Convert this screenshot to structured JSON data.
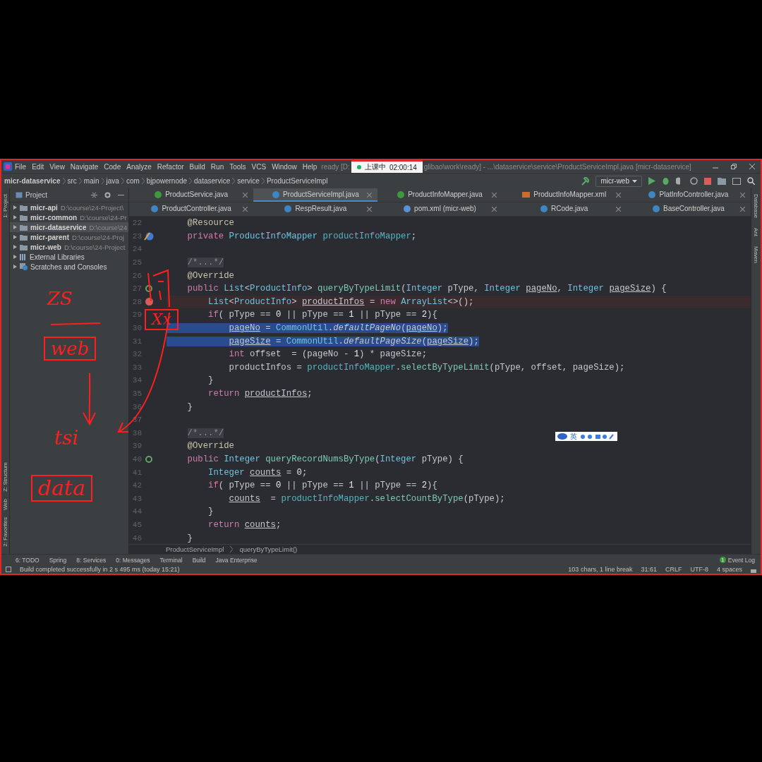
{
  "recording_widget": {
    "status": "上课中",
    "time": "02:00:14"
  },
  "menu": [
    "File",
    "Edit",
    "View",
    "Navigate",
    "Code",
    "Analyze",
    "Refactor",
    "Build",
    "Run",
    "Tools",
    "VCS",
    "Window",
    "Help"
  ],
  "window": {
    "title_start": "ready [D:",
    "title_end": "glibao\\work\\ready] - ...\\dataservice\\service\\ProductServiceImpl.java [micr-dataservice]"
  },
  "navigation": [
    "micr-dataservice",
    "src",
    "main",
    "java",
    "com",
    "bjpowernode",
    "dataservice",
    "service",
    "ProductServiceImpl"
  ],
  "run_config": "micr-web",
  "left_stripe": [
    "1: Project",
    "Z: Structure",
    "Web",
    "2: Favorites"
  ],
  "right_stripe": [
    "Database",
    "Ant",
    "Maven"
  ],
  "project_panel": {
    "title": "Project",
    "items": [
      {
        "name": "micr-api",
        "path": "D:\\course\\24-Project\\",
        "kind": "module",
        "selected": false
      },
      {
        "name": "micr-common",
        "path": "D:\\course\\24-Pr",
        "kind": "module",
        "selected": false
      },
      {
        "name": "micr-dataservice",
        "path": "D:\\course\\24",
        "kind": "module",
        "selected": true
      },
      {
        "name": "micr-parent",
        "path": "D:\\course\\24-Proj",
        "kind": "module",
        "selected": false
      },
      {
        "name": "micr-web",
        "path": "D:\\course\\24-Project",
        "kind": "module",
        "selected": false
      },
      {
        "name": "External Libraries",
        "kind": "libraries",
        "selected": false
      },
      {
        "name": "Scratches and Consoles",
        "kind": "scratches",
        "selected": false
      }
    ]
  },
  "tab_rows": [
    [
      {
        "label": "ProductService.java",
        "kind": "interface",
        "selected": false
      },
      {
        "label": "ProductServiceImpl.java",
        "kind": "class",
        "selected": true
      },
      {
        "label": "ProductInfoMapper.java",
        "kind": "interface",
        "selected": false
      },
      {
        "label": "ProductInfoMapper.xml",
        "kind": "xml",
        "selected": false
      },
      {
        "label": "PlatInfoController.java",
        "kind": "class",
        "selected": false
      }
    ],
    [
      {
        "label": "ProductController.java",
        "kind": "class",
        "selected": false
      },
      {
        "label": "RespResult.java",
        "kind": "class",
        "selected": false
      },
      {
        "label": "pom.xml (micr-web)",
        "kind": "maven",
        "selected": false
      },
      {
        "label": "RCode.java",
        "kind": "enum",
        "selected": false
      },
      {
        "label": "BaseController.java",
        "kind": "class",
        "selected": false
      }
    ]
  ],
  "code_lines": [
    {
      "number": "22",
      "tokens": [
        {
          "kind": "annotation",
          "text": "    @Resource"
        }
      ]
    },
    {
      "number": "23",
      "gutter_icon": {
        "kind": "bean"
      },
      "tokens": [
        {
          "kind": "keyword",
          "text": "    private "
        },
        {
          "kind": "type",
          "text": "ProductInfoMapper "
        },
        {
          "kind": "field",
          "text": "productInfoMapper"
        },
        {
          "kind": "plain",
          "text": ";"
        }
      ]
    },
    {
      "number": "24"
    },
    {
      "number": "25",
      "tokens": [
        {
          "kind": "fold",
          "text": "    /*...*/"
        }
      ]
    },
    {
      "number": "26",
      "tokens": [
        {
          "kind": "annotation",
          "text": "    @Override"
        }
      ]
    },
    {
      "number": "27",
      "gutter_icon": {
        "kind": "override"
      },
      "tokens": [
        {
          "kind": "keyword",
          "text": "    public "
        },
        {
          "kind": "type",
          "text": "List"
        },
        {
          "kind": "plain",
          "text": "<"
        },
        {
          "kind": "type",
          "text": "ProductInfo"
        },
        {
          "kind": "plain",
          "text": "> "
        },
        {
          "kind": "method",
          "text": "queryByTypeLimit"
        },
        {
          "kind": "plain",
          "text": "("
        },
        {
          "kind": "type",
          "text": "Integer "
        },
        {
          "kind": "plain",
          "text": "pType, "
        },
        {
          "kind": "type",
          "text": "Integer "
        },
        {
          "kind": "variable",
          "text": "pageNo"
        },
        {
          "kind": "plain",
          "text": ", "
        },
        {
          "kind": "type",
          "text": "Integer "
        },
        {
          "kind": "variable",
          "text": "pageSize"
        },
        {
          "kind": "plain",
          "text": ") {"
        }
      ]
    },
    {
      "number": "28",
      "breakpoint": true,
      "tokens": [
        {
          "kind": "type",
          "text": "        List"
        },
        {
          "kind": "plain",
          "text": "<"
        },
        {
          "kind": "type",
          "text": "ProductInfo"
        },
        {
          "kind": "plain",
          "text": "> "
        },
        {
          "kind": "variable",
          "text": "productInfos"
        },
        {
          "kind": "plain",
          "text": " = "
        },
        {
          "kind": "keyword",
          "text": "new "
        },
        {
          "kind": "type",
          "text": "ArrayList"
        },
        {
          "kind": "plain",
          "text": "<>();"
        }
      ]
    },
    {
      "number": "29",
      "tokens": [
        {
          "kind": "keyword",
          "text": "        if"
        },
        {
          "kind": "plain",
          "text": "( pType == "
        },
        {
          "kind": "number",
          "text": "0"
        },
        {
          "kind": "plain",
          "text": " || pType == "
        },
        {
          "kind": "number",
          "text": "1"
        },
        {
          "kind": "plain",
          "text": " || pType == "
        },
        {
          "kind": "number",
          "text": "2"
        },
        {
          "kind": "plain",
          "text": "){"
        }
      ]
    },
    {
      "number": "30",
      "selected": true,
      "tokens": [
        {
          "kind": "variable",
          "text": "            pageNo"
        },
        {
          "kind": "plain",
          "text": " = "
        },
        {
          "kind": "type",
          "text": "CommonUtil"
        },
        {
          "kind": "plain",
          "text": "."
        },
        {
          "kind": "static",
          "text": "defaultPageNo"
        },
        {
          "kind": "plain",
          "text": "("
        },
        {
          "kind": "variable",
          "text": "pageNo"
        },
        {
          "kind": "plain",
          "text": ");"
        }
      ]
    },
    {
      "number": "31",
      "selected": true,
      "tokens": [
        {
          "kind": "variable",
          "text": "            pageSize"
        },
        {
          "kind": "plain",
          "text": " = "
        },
        {
          "kind": "type",
          "text": "CommonUtil"
        },
        {
          "kind": "plain",
          "text": "."
        },
        {
          "kind": "static",
          "text": "defaultPageSize"
        },
        {
          "kind": "plain",
          "text": "("
        },
        {
          "kind": "variable",
          "text": "pageSize"
        },
        {
          "kind": "plain",
          "text": ");"
        }
      ]
    },
    {
      "number": "32",
      "tokens": [
        {
          "kind": "keyword",
          "text": "            int "
        },
        {
          "kind": "plain",
          "text": "offset  = (pageNo - "
        },
        {
          "kind": "number",
          "text": "1"
        },
        {
          "kind": "plain",
          "text": ") * pageSize;"
        }
      ]
    },
    {
      "number": "33",
      "tokens": [
        {
          "kind": "plain",
          "text": "            productInfos = "
        },
        {
          "kind": "field",
          "text": "productInfoMapper"
        },
        {
          "kind": "plain",
          "text": "."
        },
        {
          "kind": "method",
          "text": "selectByTypeLimit"
        },
        {
          "kind": "plain",
          "text": "(pType, offset, pageSize);"
        }
      ]
    },
    {
      "number": "34",
      "tokens": [
        {
          "kind": "plain",
          "text": "        }"
        }
      ]
    },
    {
      "number": "35",
      "tokens": [
        {
          "kind": "keyword",
          "text": "        return "
        },
        {
          "kind": "variable",
          "text": "productInfos"
        },
        {
          "kind": "plain",
          "text": ";"
        }
      ]
    },
    {
      "number": "36",
      "tokens": [
        {
          "kind": "plain",
          "text": "    }"
        }
      ]
    },
    {
      "number": "37"
    },
    {
      "number": "38",
      "tokens": [
        {
          "kind": "fold",
          "text": "    /*...*/"
        }
      ]
    },
    {
      "number": "39",
      "tokens": [
        {
          "kind": "annotation",
          "text": "    @Override"
        }
      ]
    },
    {
      "number": "40",
      "gutter_icon": {
        "kind": "override"
      },
      "tokens": [
        {
          "kind": "keyword",
          "text": "    public "
        },
        {
          "kind": "type",
          "text": "Integer "
        },
        {
          "kind": "method",
          "text": "queryRecordNumsByType"
        },
        {
          "kind": "plain",
          "text": "("
        },
        {
          "kind": "type",
          "text": "Integer "
        },
        {
          "kind": "plain",
          "text": "pType) {"
        }
      ]
    },
    {
      "number": "41",
      "tokens": [
        {
          "kind": "type",
          "text": "        Integer "
        },
        {
          "kind": "variable",
          "text": "counts"
        },
        {
          "kind": "plain",
          "text": " = "
        },
        {
          "kind": "number",
          "text": "0"
        },
        {
          "kind": "plain",
          "text": ";"
        }
      ]
    },
    {
      "number": "42",
      "tokens": [
        {
          "kind": "keyword",
          "text": "        if"
        },
        {
          "kind": "plain",
          "text": "( pType == "
        },
        {
          "kind": "number",
          "text": "0"
        },
        {
          "kind": "plain",
          "text": " || pType == "
        },
        {
          "kind": "number",
          "text": "1"
        },
        {
          "kind": "plain",
          "text": " || pType == "
        },
        {
          "kind": "number",
          "text": "2"
        },
        {
          "kind": "plain",
          "text": "){"
        }
      ]
    },
    {
      "number": "43",
      "tokens": [
        {
          "kind": "variable",
          "text": "            counts"
        },
        {
          "kind": "plain",
          "text": "  = "
        },
        {
          "kind": "field",
          "text": "productInfoMapper"
        },
        {
          "kind": "plain",
          "text": "."
        },
        {
          "kind": "method",
          "text": "selectCountByType"
        },
        {
          "kind": "plain",
          "text": "(pType);"
        }
      ]
    },
    {
      "number": "44",
      "tokens": [
        {
          "kind": "plain",
          "text": "        }"
        }
      ]
    },
    {
      "number": "45",
      "tokens": [
        {
          "kind": "keyword",
          "text": "        return "
        },
        {
          "kind": "variable",
          "text": "counts"
        },
        {
          "kind": "plain",
          "text": ";"
        }
      ]
    },
    {
      "number": "46",
      "tokens": [
        {
          "kind": "plain",
          "text": "    }"
        }
      ]
    }
  ],
  "editor_breadcrumb": [
    "ProductServiceImpl",
    "queryByTypeLimit()"
  ],
  "ime_bar": {
    "label": "英"
  },
  "annotations": [
    {
      "text": "ZS",
      "boxed": false
    },
    {
      "text": "web",
      "boxed": true
    },
    {
      "text": "tsi",
      "boxed": false
    },
    {
      "text": "data",
      "boxed": true
    },
    {
      "text": "Xx",
      "boxed": true
    }
  ],
  "tool_tabs": [
    "6: TODO",
    "Spring",
    "8: Services",
    "0: Messages",
    "Terminal",
    "Build",
    "Java Enterprise"
  ],
  "event_log": {
    "label": "Event Log",
    "count": "1"
  },
  "status_bar": {
    "message": "Build completed successfully in 2 s 495 ms (today 15:21)",
    "items": [
      "103 chars, 1 line break",
      "31:61",
      "CRLF",
      "UTF-8",
      "4 spaces"
    ]
  }
}
